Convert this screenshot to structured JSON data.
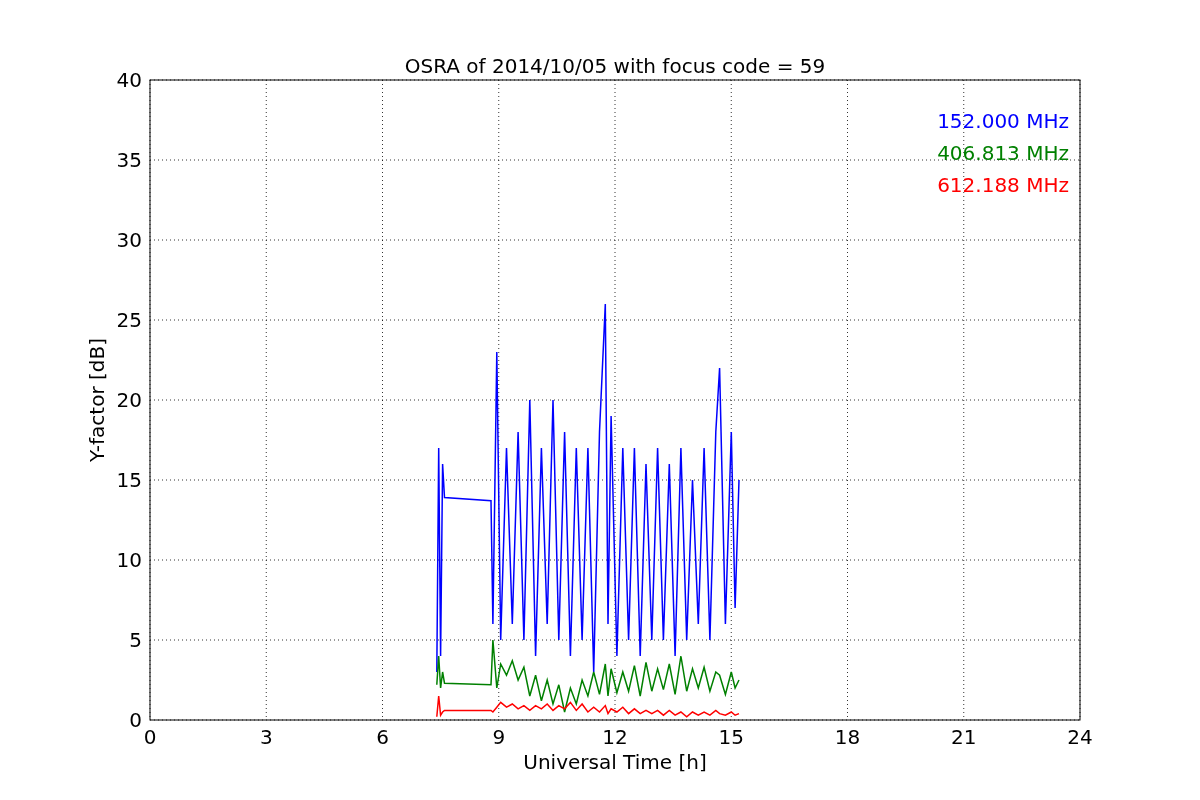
{
  "chart_data": {
    "type": "line",
    "grid": true,
    "title": "OSRA of 2014/10/05 with focus code = 59",
    "xlabel": "Universal Time [h]",
    "ylabel": "Y-factor [dB]",
    "xlim": [
      0,
      24
    ],
    "ylim": [
      0,
      40
    ],
    "xticks": [
      0,
      3,
      6,
      9,
      12,
      15,
      18,
      21,
      24
    ],
    "yticks": [
      0,
      5,
      10,
      15,
      20,
      25,
      30,
      35,
      40
    ],
    "x": [
      7.4,
      7.45,
      7.5,
      7.55,
      7.6,
      8.8,
      8.85,
      8.95,
      9.05,
      9.2,
      9.35,
      9.5,
      9.65,
      9.8,
      9.95,
      10.1,
      10.25,
      10.4,
      10.55,
      10.7,
      10.85,
      11.0,
      11.15,
      11.3,
      11.45,
      11.6,
      11.75,
      11.82,
      11.9,
      12.05,
      12.2,
      12.35,
      12.5,
      12.65,
      12.8,
      12.95,
      13.1,
      13.25,
      13.4,
      13.55,
      13.7,
      13.85,
      14.0,
      14.15,
      14.3,
      14.45,
      14.6,
      14.7,
      14.85,
      15.0,
      15.1,
      15.2
    ],
    "series": [
      {
        "name": "152.000 MHz",
        "color": "#0000ff",
        "values": [
          3,
          17,
          4,
          16,
          13.9,
          13.7,
          6,
          23,
          5,
          17,
          6,
          18,
          5,
          20,
          4,
          17,
          6,
          20,
          5,
          18,
          4,
          17,
          5,
          17,
          3,
          18,
          26,
          6,
          19,
          4,
          17,
          5,
          17,
          4,
          16,
          5,
          17,
          5,
          16,
          4,
          17,
          5,
          15,
          6,
          17,
          5,
          18,
          22,
          6,
          18,
          7,
          15
        ]
      },
      {
        "name": "406.813 MHz",
        "color": "#008000",
        "values": [
          2.2,
          4,
          2,
          3,
          2.3,
          2.2,
          5,
          2,
          3.5,
          2.8,
          3.7,
          2.5,
          3.3,
          1.5,
          2.8,
          1.2,
          2.5,
          1,
          2.2,
          0.5,
          2,
          1,
          2.5,
          1.5,
          3,
          1.6,
          3.5,
          1.5,
          3.2,
          1.7,
          3,
          1.8,
          3.4,
          1.5,
          3.6,
          1.8,
          3.2,
          1.9,
          3.5,
          1.6,
          4,
          1.8,
          3.2,
          2,
          3.3,
          1.8,
          3,
          2.8,
          1.6,
          3,
          2,
          2.5
        ]
      },
      {
        "name": "612.188 MHz",
        "color": "#ff0000",
        "values": [
          0.2,
          1.5,
          0.3,
          0.5,
          0.6,
          0.6,
          0.5,
          0.8,
          1.1,
          0.8,
          1,
          0.7,
          0.9,
          0.6,
          0.9,
          0.7,
          1,
          0.6,
          0.9,
          0.7,
          1.1,
          0.6,
          1,
          0.5,
          0.8,
          0.5,
          0.9,
          0.4,
          0.7,
          0.5,
          0.8,
          0.4,
          0.7,
          0.4,
          0.6,
          0.4,
          0.6,
          0.3,
          0.6,
          0.3,
          0.5,
          0.2,
          0.5,
          0.3,
          0.5,
          0.3,
          0.6,
          0.4,
          0.3,
          0.5,
          0.3,
          0.4
        ]
      }
    ]
  }
}
